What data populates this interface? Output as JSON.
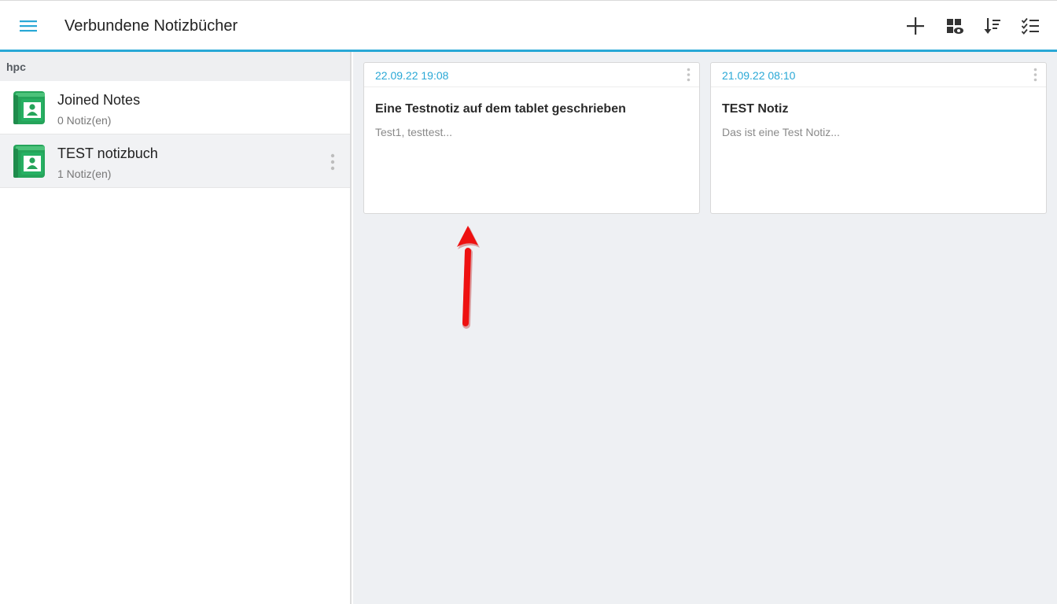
{
  "appbar": {
    "title": "Verbundene Notizbücher",
    "icons": [
      "menu-icon",
      "add-icon",
      "view-mode-icon",
      "sort-icon",
      "checklist-icon"
    ],
    "accent_color": "#29a8d6"
  },
  "sidebar": {
    "group_label": "hpc",
    "notebooks": [
      {
        "name": "Joined Notes",
        "count": "0 Notiz(en)",
        "icon": "notebook-icon"
      },
      {
        "name": "TEST notizbuch",
        "count": "1 Notiz(en)",
        "icon": "notebook-icon"
      }
    ],
    "notebook_color": "#25a45a"
  },
  "notes": [
    {
      "date": "22.09.22 19:08",
      "title": "Eine Testnotiz auf dem tablet geschrieben",
      "preview": "Test1, testtest..."
    },
    {
      "date": "21.09.22 08:10",
      "title": "TEST Notiz",
      "preview": "Das ist eine Test Notiz..."
    }
  ],
  "annotation": {
    "icon": "red-arrow-annotation",
    "color": "#ee1111"
  }
}
